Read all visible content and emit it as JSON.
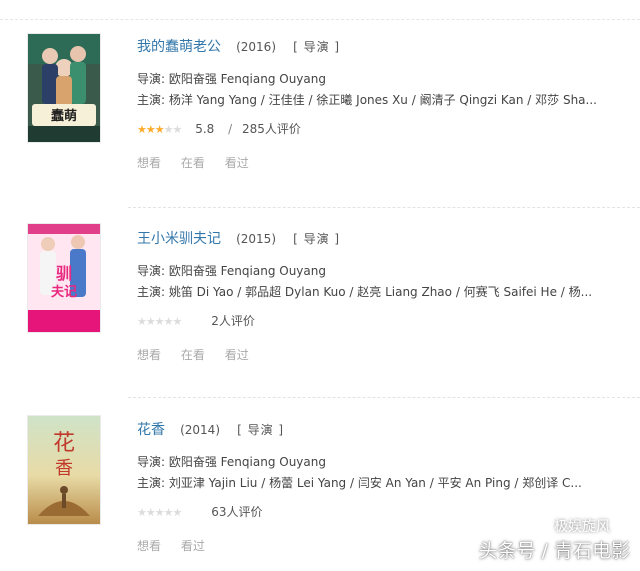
{
  "movies": [
    {
      "title": "我的蠢萌老公",
      "year": "(2016)",
      "role": "[ 导演 ]",
      "director": "导演: 欧阳奋强 Fenqiang Ouyang",
      "cast": "主演: 杨洋 Yang Yang / 汪佳佳 / 徐正曦 Jones Xu / 阚清子 Qingzi Kan / 邓莎 Sha...",
      "star_fraction": 0.6,
      "score": "5.8",
      "separator": "/",
      "ratings_count": "285人评价",
      "actions": [
        "想看",
        "在看",
        "看过"
      ]
    },
    {
      "title": "王小米驯夫记",
      "year": "(2015)",
      "role": "[ 导演 ]",
      "director": "导演: 欧阳奋强 Fenqiang Ouyang",
      "cast": "主演: 姚笛 Di Yao / 郭品超 Dylan Kuo / 赵亮 Liang Zhao / 何赛飞 Saifei He / 杨...",
      "star_fraction": 0,
      "score": "",
      "separator": "",
      "ratings_count": "2人评价",
      "actions": [
        "想看",
        "在看",
        "看过"
      ]
    },
    {
      "title": "花香",
      "year": "(2014)",
      "role": "[ 导演 ]",
      "director": "导演: 欧阳奋强 Fenqiang Ouyang",
      "cast": "主演: 刘亚津 Yajin Liu / 杨蕾 Lei Yang / 闫安 An Yan / 平安 An Ping / 郑创译 C...",
      "star_fraction": 0,
      "score": "",
      "separator": "",
      "ratings_count": "63人评价",
      "actions": [
        "想看",
        "看过"
      ]
    }
  ],
  "watermark": {
    "line1": "极娱旋风",
    "line2": "头条号 / 青石电影"
  },
  "colors": {
    "title_link": "#3377aa",
    "star_on": "#ffac2d",
    "star_off": "#dcdcdc",
    "action_text": "#aaaaaa"
  }
}
